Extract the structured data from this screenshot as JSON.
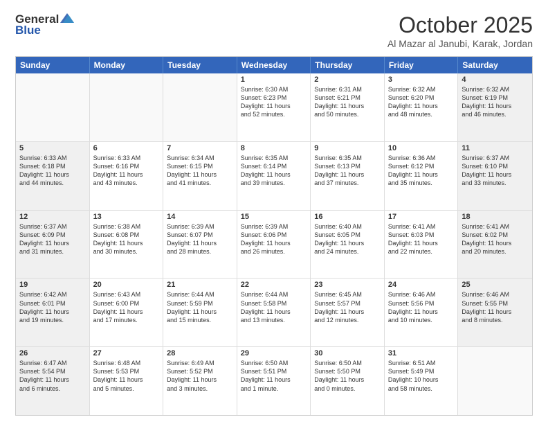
{
  "header": {
    "logo_general": "General",
    "logo_blue": "Blue",
    "month_title": "October 2025",
    "location": "Al Mazar al Janubi, Karak, Jordan"
  },
  "weekdays": [
    "Sunday",
    "Monday",
    "Tuesday",
    "Wednesday",
    "Thursday",
    "Friday",
    "Saturday"
  ],
  "rows": [
    [
      {
        "day": "",
        "text": "",
        "empty": true
      },
      {
        "day": "",
        "text": "",
        "empty": true
      },
      {
        "day": "",
        "text": "",
        "empty": true
      },
      {
        "day": "1",
        "text": "Sunrise: 6:30 AM\nSunset: 6:23 PM\nDaylight: 11 hours\nand 52 minutes.",
        "shaded": false
      },
      {
        "day": "2",
        "text": "Sunrise: 6:31 AM\nSunset: 6:21 PM\nDaylight: 11 hours\nand 50 minutes.",
        "shaded": false
      },
      {
        "day": "3",
        "text": "Sunrise: 6:32 AM\nSunset: 6:20 PM\nDaylight: 11 hours\nand 48 minutes.",
        "shaded": false
      },
      {
        "day": "4",
        "text": "Sunrise: 6:32 AM\nSunset: 6:19 PM\nDaylight: 11 hours\nand 46 minutes.",
        "shaded": true
      }
    ],
    [
      {
        "day": "5",
        "text": "Sunrise: 6:33 AM\nSunset: 6:18 PM\nDaylight: 11 hours\nand 44 minutes.",
        "shaded": true
      },
      {
        "day": "6",
        "text": "Sunrise: 6:33 AM\nSunset: 6:16 PM\nDaylight: 11 hours\nand 43 minutes.",
        "shaded": false
      },
      {
        "day": "7",
        "text": "Sunrise: 6:34 AM\nSunset: 6:15 PM\nDaylight: 11 hours\nand 41 minutes.",
        "shaded": false
      },
      {
        "day": "8",
        "text": "Sunrise: 6:35 AM\nSunset: 6:14 PM\nDaylight: 11 hours\nand 39 minutes.",
        "shaded": false
      },
      {
        "day": "9",
        "text": "Sunrise: 6:35 AM\nSunset: 6:13 PM\nDaylight: 11 hours\nand 37 minutes.",
        "shaded": false
      },
      {
        "day": "10",
        "text": "Sunrise: 6:36 AM\nSunset: 6:12 PM\nDaylight: 11 hours\nand 35 minutes.",
        "shaded": false
      },
      {
        "day": "11",
        "text": "Sunrise: 6:37 AM\nSunset: 6:10 PM\nDaylight: 11 hours\nand 33 minutes.",
        "shaded": true
      }
    ],
    [
      {
        "day": "12",
        "text": "Sunrise: 6:37 AM\nSunset: 6:09 PM\nDaylight: 11 hours\nand 31 minutes.",
        "shaded": true
      },
      {
        "day": "13",
        "text": "Sunrise: 6:38 AM\nSunset: 6:08 PM\nDaylight: 11 hours\nand 30 minutes.",
        "shaded": false
      },
      {
        "day": "14",
        "text": "Sunrise: 6:39 AM\nSunset: 6:07 PM\nDaylight: 11 hours\nand 28 minutes.",
        "shaded": false
      },
      {
        "day": "15",
        "text": "Sunrise: 6:39 AM\nSunset: 6:06 PM\nDaylight: 11 hours\nand 26 minutes.",
        "shaded": false
      },
      {
        "day": "16",
        "text": "Sunrise: 6:40 AM\nSunset: 6:05 PM\nDaylight: 11 hours\nand 24 minutes.",
        "shaded": false
      },
      {
        "day": "17",
        "text": "Sunrise: 6:41 AM\nSunset: 6:03 PM\nDaylight: 11 hours\nand 22 minutes.",
        "shaded": false
      },
      {
        "day": "18",
        "text": "Sunrise: 6:41 AM\nSunset: 6:02 PM\nDaylight: 11 hours\nand 20 minutes.",
        "shaded": true
      }
    ],
    [
      {
        "day": "19",
        "text": "Sunrise: 6:42 AM\nSunset: 6:01 PM\nDaylight: 11 hours\nand 19 minutes.",
        "shaded": true
      },
      {
        "day": "20",
        "text": "Sunrise: 6:43 AM\nSunset: 6:00 PM\nDaylight: 11 hours\nand 17 minutes.",
        "shaded": false
      },
      {
        "day": "21",
        "text": "Sunrise: 6:44 AM\nSunset: 5:59 PM\nDaylight: 11 hours\nand 15 minutes.",
        "shaded": false
      },
      {
        "day": "22",
        "text": "Sunrise: 6:44 AM\nSunset: 5:58 PM\nDaylight: 11 hours\nand 13 minutes.",
        "shaded": false
      },
      {
        "day": "23",
        "text": "Sunrise: 6:45 AM\nSunset: 5:57 PM\nDaylight: 11 hours\nand 12 minutes.",
        "shaded": false
      },
      {
        "day": "24",
        "text": "Sunrise: 6:46 AM\nSunset: 5:56 PM\nDaylight: 11 hours\nand 10 minutes.",
        "shaded": false
      },
      {
        "day": "25",
        "text": "Sunrise: 6:46 AM\nSunset: 5:55 PM\nDaylight: 11 hours\nand 8 minutes.",
        "shaded": true
      }
    ],
    [
      {
        "day": "26",
        "text": "Sunrise: 6:47 AM\nSunset: 5:54 PM\nDaylight: 11 hours\nand 6 minutes.",
        "shaded": true
      },
      {
        "day": "27",
        "text": "Sunrise: 6:48 AM\nSunset: 5:53 PM\nDaylight: 11 hours\nand 5 minutes.",
        "shaded": false
      },
      {
        "day": "28",
        "text": "Sunrise: 6:49 AM\nSunset: 5:52 PM\nDaylight: 11 hours\nand 3 minutes.",
        "shaded": false
      },
      {
        "day": "29",
        "text": "Sunrise: 6:50 AM\nSunset: 5:51 PM\nDaylight: 11 hours\nand 1 minute.",
        "shaded": false
      },
      {
        "day": "30",
        "text": "Sunrise: 6:50 AM\nSunset: 5:50 PM\nDaylight: 11 hours\nand 0 minutes.",
        "shaded": false
      },
      {
        "day": "31",
        "text": "Sunrise: 6:51 AM\nSunset: 5:49 PM\nDaylight: 10 hours\nand 58 minutes.",
        "shaded": false
      },
      {
        "day": "",
        "text": "",
        "empty": true
      }
    ]
  ]
}
